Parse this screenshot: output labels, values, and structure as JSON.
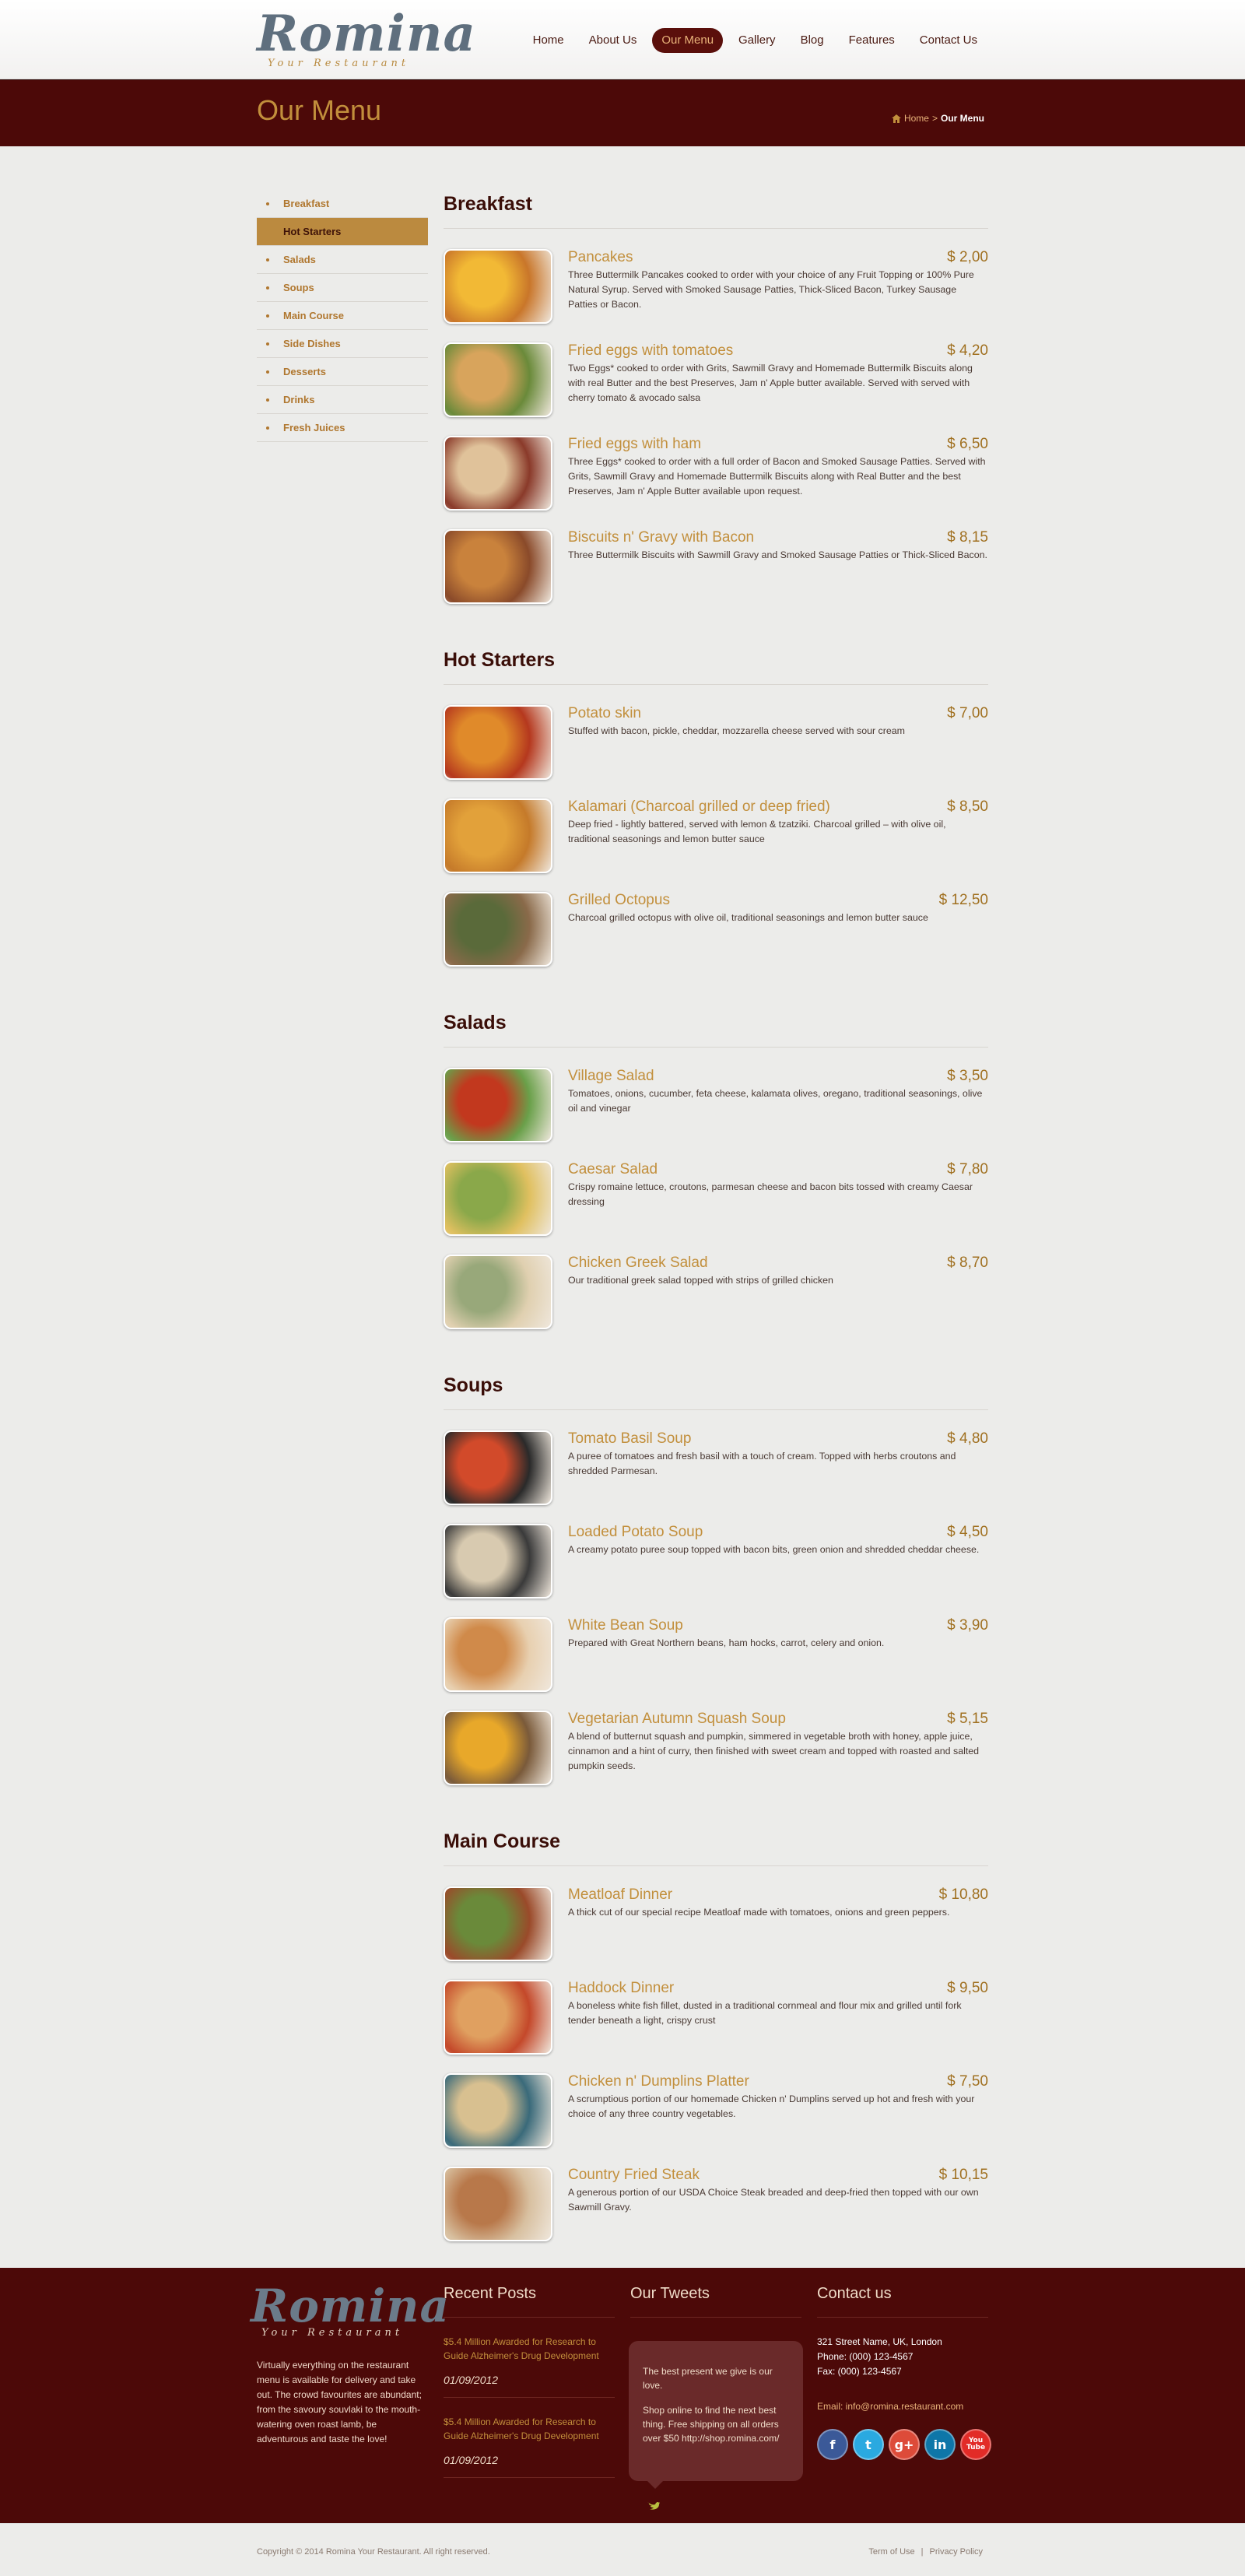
{
  "logo": {
    "name": "Romina",
    "tagline": "Your Restaurant"
  },
  "nav": [
    "Home",
    "About Us",
    "Our Menu",
    "Gallery",
    "Blog",
    "Features",
    "Contact Us"
  ],
  "nav_active": "Our Menu",
  "page_title": "Our Menu",
  "breadcrumb": {
    "home": "Home",
    "separator": ">",
    "current": "Our Menu"
  },
  "sidebar": [
    "Breakfast",
    "Hot Starters",
    "Salads",
    "Soups",
    "Main Course",
    "Side Dishes",
    "Desserts",
    "Drinks",
    "Fresh Juices"
  ],
  "sidebar_active": "Hot Starters",
  "sections": [
    {
      "title": "Breakfast",
      "items": [
        {
          "name": "Pancakes",
          "price": "$ 2,00",
          "desc": "Three Buttermilk Pancakes  cooked to order with your choice of any Fruit Topping or 100% Pure Natural Syrup. Served with Smoked Sausage Patties, Thick-Sliced Bacon, Turkey Sausage Patties or Bacon."
        },
        {
          "name": "Fried eggs with tomatoes",
          "price": "$ 4,20",
          "desc": "Two Eggs* cooked to order with Grits, Sawmill Gravy and Homemade Buttermilk Biscuits along with real Butter and the best Preserves, Jam n' Apple butter available. Served with served with cherry tomato & avocado salsa"
        },
        {
          "name": "Fried eggs with ham",
          "price": "$   6,50",
          "desc": "Three Eggs* cooked to order with a full order of Bacon and Smoked Sausage Patties. Served with Grits, Sawmill Gravy and Homemade Buttermilk Biscuits along with Real Butter and the best Preserves, Jam n' Apple Butter available upon request."
        },
        {
          "name": "Biscuits n' Gravy with Bacon",
          "price": "$ 8,15",
          "desc": "Three Buttermilk Biscuits with Sawmill Gravy and Smoked Sausage Patties or Thick-Sliced Bacon."
        }
      ]
    },
    {
      "title": "Hot Starters",
      "items": [
        {
          "name": "Potato skin",
          "price": "$ 7,00",
          "desc": "Stuffed with bacon, pickle, cheddar, mozzarella cheese served with sour cream"
        },
        {
          "name": "Kalamari (Charcoal grilled or deep fried)",
          "price": "$ 8,50",
          "desc": "Deep fried - lightly battered, served with lemon & tzatziki. Charcoal grilled – with olive oil, traditional seasonings and lemon butter sauce"
        },
        {
          "name": "Grilled Octopus",
          "price": "$ 12,50",
          "desc": "Charcoal grilled octopus with olive oil, traditional seasonings and lemon butter sauce"
        }
      ]
    },
    {
      "title": "Salads",
      "items": [
        {
          "name": "Village Salad",
          "price": "$ 3,50",
          "desc": "Tomatoes, onions, cucumber, feta cheese, kalamata olives, oregano, traditional seasonings, olive oil and vinegar"
        },
        {
          "name": "Caesar Salad",
          "price": "$ 7,80",
          "desc": "Crispy romaine lettuce, croutons, parmesan cheese and bacon bits tossed with creamy Caesar dressing"
        },
        {
          "name": "Chicken Greek Salad",
          "price": "$ 8,70",
          "desc": "Our traditional greek salad topped with strips of grilled chicken"
        }
      ]
    },
    {
      "title": "Soups",
      "items": [
        {
          "name": "Tomato Basil Soup",
          "price": "$ 4,80",
          "desc": "A puree of tomatoes and fresh basil with a touch of cream. Topped with herbs croutons and shredded Parmesan."
        },
        {
          "name": "Loaded Potato Soup",
          "price": "$ 4,50",
          "desc": "A creamy potato puree soup topped with bacon bits, green onion and shredded cheddar cheese."
        },
        {
          "name": "White Bean Soup",
          "price": "$ 3,90",
          "desc": "Prepared with Great Northern beans, ham hocks, carrot, celery and onion."
        },
        {
          "name": "Vegetarian Autumn Squash Soup",
          "price": "$ 5,15",
          "desc": "A blend of butternut squash and pumpkin, simmered in vegetable broth with honey, apple juice, cinnamon and a hint of curry, then finished with sweet cream and topped with roasted and salted pumpkin seeds."
        }
      ]
    },
    {
      "title": "Main Course",
      "items": [
        {
          "name": "Meatloaf Dinner",
          "price": "$ 10,80",
          "desc": "A thick cut of our special recipe Meatloaf made with tomatoes, onions and green peppers."
        },
        {
          "name": "Haddock Dinner",
          "price": "$ 9,50",
          "desc": "A boneless white fish fillet, dusted in a traditional cornmeal and flour mix and grilled until fork tender beneath a light, crispy crust"
        },
        {
          "name": "Chicken n' Dumplins Platter",
          "price": "$ 7,50",
          "desc": "A scrumptious portion of our homemade Chicken n' Dumplins served up hot and fresh with your choice of any three country vegetables."
        },
        {
          "name": "Country Fried Steak",
          "price": "$ 10,15",
          "desc": "A generous portion of our USDA Choice Steak breaded and deep-fried then topped with our own Sawmill Gravy."
        }
      ]
    }
  ],
  "footer": {
    "about": "Virtually everything on the restaurant menu is available for delivery and take out. The crowd favourites are abundant; from the savoury souvlaki to the mouth-watering oven roast lamb, be adventurous and taste the love!",
    "recent_posts_title": "Recent Posts",
    "posts": [
      {
        "title": "$5.4 Million Awarded for Research to Guide Alzheimer's Drug Development",
        "date": "01/09/2012"
      },
      {
        "title": "$5.4 Million Awarded for Research to Guide Alzheimer's Drug Development",
        "date": "01/09/2012"
      }
    ],
    "tweets_title": "Our Tweets",
    "tweets": [
      "The best present we give is our love.",
      "Shop online to find the next best thing. Free shipping on all orders over $50 http://shop.romina.com/"
    ],
    "contact_title": "Contact us",
    "address": "321 Street Name, UK, London",
    "phone": "Phone: (000) 123-4567",
    "fax": "Fax: (000) 123-4567",
    "email": "Email: info@romina.restaurant.com",
    "social": [
      {
        "name": "facebook-icon",
        "glyph": "f",
        "color": "#3b5998"
      },
      {
        "name": "twitter-icon",
        "glyph": "t",
        "color": "#2aa9e0"
      },
      {
        "name": "google-plus-icon",
        "glyph": "g+",
        "color": "#dd4b39"
      },
      {
        "name": "linkedin-icon",
        "glyph": "in",
        "color": "#0e76a8"
      },
      {
        "name": "youtube-icon",
        "glyph": "You Tube",
        "color": "#e22b27"
      }
    ]
  },
  "copyright": "Copyright © 2014 Romina Your Restaurant. All right reserved.",
  "legal": [
    "Term of Use",
    "|",
    "Privacy Policy"
  ],
  "thumb_colors": [
    [
      "#f2b935",
      "#c9762a"
    ],
    [
      "#d8a45c",
      "#6a8a3a"
    ],
    [
      "#e0c29a",
      "#8a3a2a"
    ],
    [
      "#c9823c",
      "#8a4a2a"
    ],
    [
      "#e08a2a",
      "#b5381e"
    ],
    [
      "#e2a13a",
      "#c57a2a"
    ],
    [
      "#5a6a3a",
      "#8a6a4a"
    ],
    [
      "#c2381e",
      "#6aa04a"
    ],
    [
      "#8aa84a",
      "#e0c060"
    ],
    [
      "#98a87a",
      "#e0d0b0"
    ],
    [
      "#d24a2a",
      "#2a2a2a"
    ],
    [
      "#d8cab0",
      "#3a3a3a"
    ],
    [
      "#d08a4a",
      "#e8d0b0"
    ],
    [
      "#e8a82a",
      "#7a5a3a"
    ],
    [
      "#6a8a3a",
      "#9a4a2a"
    ],
    [
      "#e0a060",
      "#c4482a"
    ],
    [
      "#d8c090",
      "#3a6a7a"
    ],
    [
      "#b8784a",
      "#d8c0a0"
    ]
  ]
}
